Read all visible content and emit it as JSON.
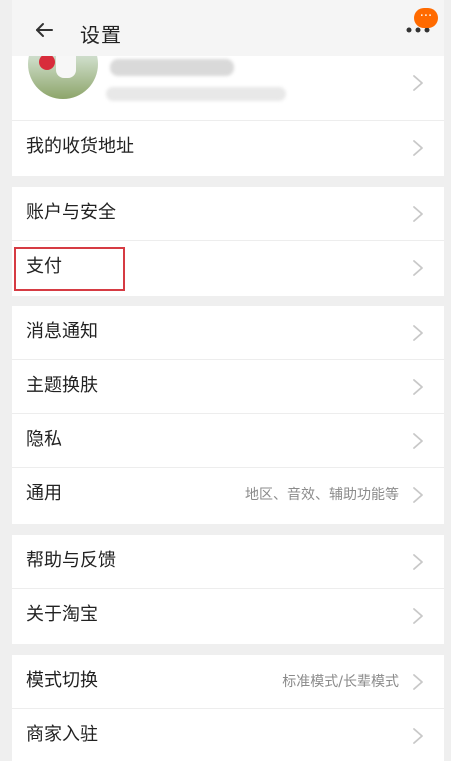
{
  "header": {
    "title": "设置",
    "back_icon": "arrow-left-icon",
    "more_icon": "more-dots-icon",
    "badge_text": "···",
    "badge_color": "#ff6a00"
  },
  "profile": {
    "avatar_icon": "profile-avatar",
    "chevron_icon": "chevron-right-icon"
  },
  "sections": [
    {
      "items": [
        {
          "label": "我的收货地址",
          "chevron_icon": "chevron-right-icon"
        }
      ]
    },
    {
      "items": [
        {
          "label": "账户与安全",
          "chevron_icon": "chevron-right-icon"
        },
        {
          "label": "支付",
          "chevron_icon": "chevron-right-icon"
        }
      ]
    },
    {
      "items": [
        {
          "label": "消息通知",
          "chevron_icon": "chevron-right-icon"
        },
        {
          "label": "主题换肤",
          "chevron_icon": "chevron-right-icon"
        },
        {
          "label": "隐私",
          "chevron_icon": "chevron-right-icon"
        },
        {
          "label": "通用",
          "detail": "地区、音效、辅助功能等",
          "chevron_icon": "chevron-right-icon"
        }
      ]
    },
    {
      "items": [
        {
          "label": "帮助与反馈",
          "chevron_icon": "chevron-right-icon"
        },
        {
          "label": "关于淘宝",
          "chevron_icon": "chevron-right-icon"
        }
      ]
    },
    {
      "items": [
        {
          "label": "模式切换",
          "detail": "标准模式/长辈模式",
          "chevron_icon": "chevron-right-icon"
        },
        {
          "label": "商家入驻",
          "chevron_icon": "chevron-right-icon"
        }
      ]
    }
  ],
  "annotation": {
    "highlight_color": "#d63b43"
  }
}
